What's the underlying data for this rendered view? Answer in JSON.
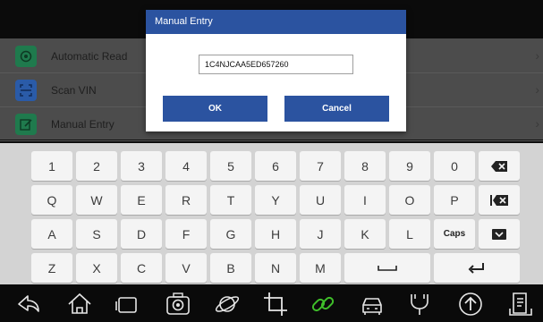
{
  "menu": {
    "items": [
      {
        "label": "Automatic Read",
        "icon": "auto-read-icon",
        "icon_color": "#1f7a4d"
      },
      {
        "label": "Scan VIN",
        "icon": "scan-icon",
        "icon_color": "#2a5ba8"
      },
      {
        "label": "Manual Entry",
        "icon": "edit-icon",
        "icon_color": "#1f7a4d"
      }
    ]
  },
  "dialog": {
    "title": "Manual Entry",
    "vin_value": "1C4NJCAA5ED657260",
    "ok_label": "OK",
    "cancel_label": "Cancel"
  },
  "keyboard": {
    "row1": [
      "1",
      "2",
      "3",
      "4",
      "5",
      "6",
      "7",
      "8",
      "9",
      "0"
    ],
    "row2": [
      "Q",
      "W",
      "E",
      "R",
      "T",
      "Y",
      "U",
      "I",
      "O",
      "P"
    ],
    "row3": [
      "A",
      "S",
      "D",
      "F",
      "G",
      "H",
      "J",
      "K",
      "L"
    ],
    "row4": [
      "Z",
      "X",
      "C",
      "V",
      "B",
      "N",
      "M"
    ],
    "caps_label": "Caps"
  },
  "bottom_nav": [
    "back-icon",
    "home-icon",
    "recent-apps-icon",
    "camera-icon",
    "browser-icon",
    "crop-icon",
    "link-icon",
    "car-icon",
    "vci-icon",
    "upload-icon",
    "report-icon"
  ],
  "colors": {
    "accent": "#2b53a0",
    "link_icon": "#3fbf2a"
  }
}
